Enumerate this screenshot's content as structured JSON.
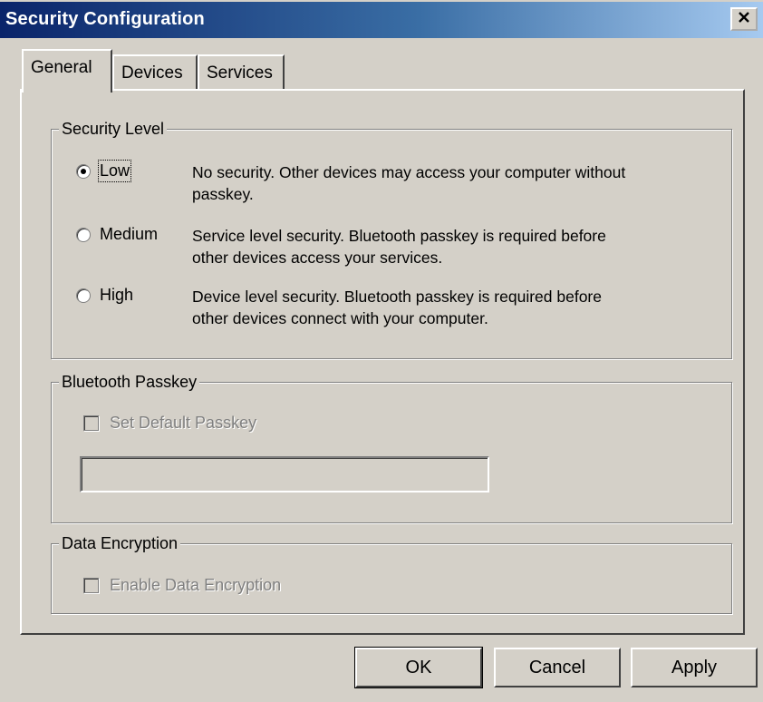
{
  "window": {
    "title": "Security Configuration",
    "close_icon": "close-icon"
  },
  "tabs": [
    {
      "label": "General",
      "active": true
    },
    {
      "label": "Devices",
      "active": false
    },
    {
      "label": "Services",
      "active": false
    }
  ],
  "security_level": {
    "group_label": "Security Level",
    "options": [
      {
        "label": "Low",
        "selected": true,
        "desc_1": "No security. Other devices may access your computer without",
        "desc_2": "passkey."
      },
      {
        "label": "Medium",
        "selected": false,
        "desc_1": "Service level security. Bluetooth passkey is required before",
        "desc_2": "other devices access your services."
      },
      {
        "label": "High",
        "selected": false,
        "desc_1": "Device level security. Bluetooth passkey is required before",
        "desc_2": "other devices connect with your computer."
      }
    ]
  },
  "bluetooth_passkey": {
    "group_label": "Bluetooth Passkey",
    "checkbox_label": "Set Default Passkey",
    "checked": false,
    "enabled": false,
    "value": ""
  },
  "data_encryption": {
    "group_label": "Data Encryption",
    "checkbox_label": "Enable Data Encryption",
    "checked": false,
    "enabled": false
  },
  "buttons": {
    "ok": "OK",
    "cancel": "Cancel",
    "apply": "Apply"
  }
}
